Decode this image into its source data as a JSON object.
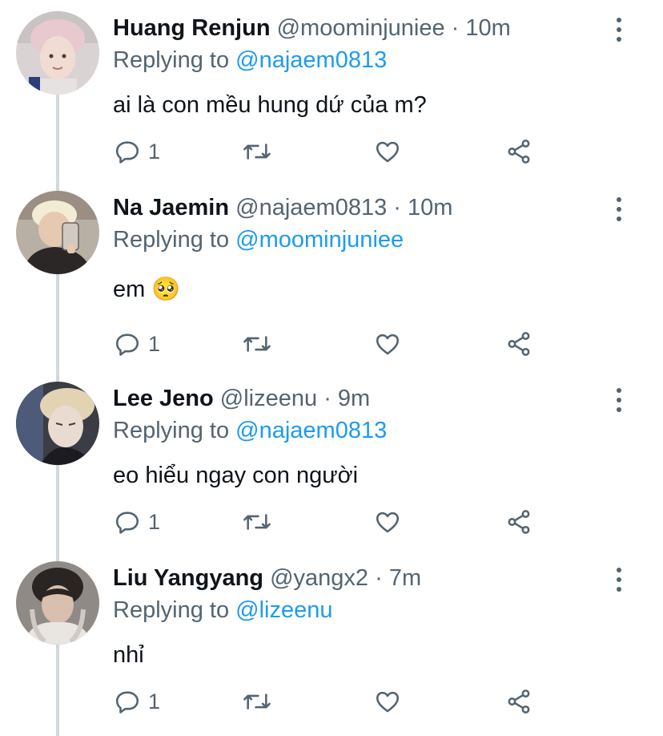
{
  "theme": {
    "text": "#0f1419",
    "muted": "#536471",
    "link": "#1d9bf0",
    "thread_line": "#cfd9de"
  },
  "tweets": [
    {
      "name": "Huang Renjun",
      "handle": "@moominjuniee",
      "time": "10m",
      "replying_prefix": "Replying to",
      "replying_to": "@najaem0813",
      "text": "ai là con mều hung dứ của m?",
      "emoji": "",
      "reply_count": "1",
      "avatar": "user-avatar-photo"
    },
    {
      "name": "Na Jaemin",
      "handle": "@najaem0813",
      "time": "10m",
      "replying_prefix": "Replying to",
      "replying_to": "@moominjuniee",
      "text": "em",
      "emoji": "🥺",
      "reply_count": "1",
      "avatar": "user-avatar-photo"
    },
    {
      "name": "Lee Jeno",
      "handle": "@lizeenu",
      "time": "9m",
      "replying_prefix": "Replying to",
      "replying_to": "@najaem0813",
      "text": "eo hiểu ngay con người",
      "emoji": "",
      "reply_count": "1",
      "avatar": "user-avatar-photo"
    },
    {
      "name": "Liu Yangyang",
      "handle": "@yangx2",
      "time": "7m",
      "replying_prefix": "Replying to",
      "replying_to": "@lizeenu",
      "text": "nhỉ",
      "emoji": "",
      "reply_count": "1",
      "avatar": "user-avatar-photo"
    }
  ],
  "icons": {
    "reply": "reply-icon",
    "retweet": "retweet-icon",
    "like": "like-icon",
    "share": "share-icon",
    "more": "more-options-icon"
  }
}
